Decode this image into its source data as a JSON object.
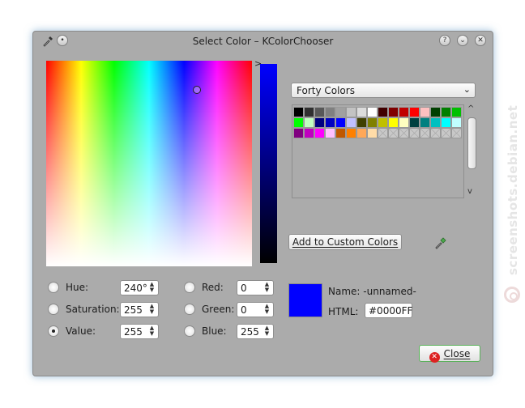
{
  "window": {
    "title": "Select Color – KColorChooser"
  },
  "titlebar_buttons": [
    {
      "name": "help-button",
      "glyph": "?"
    },
    {
      "name": "minimize-button",
      "glyph": "⌄"
    },
    {
      "name": "close-window-button",
      "glyph": "✕"
    }
  ],
  "palette": {
    "selected": "Forty Colors",
    "colors": [
      "#000000",
      "#303030",
      "#585858",
      "#808080",
      "#a0a0a0",
      "#c3c3c3",
      "#dcdcdc",
      "#ffffff",
      "#400000",
      "#800000",
      "#c00000",
      "#ff0000",
      "#ffc0c0",
      "#004000",
      "#008000",
      "#00c000",
      "#00ff00",
      "#c0ffc0",
      "#000080",
      "#0000c0",
      "#0000ff",
      "#c0c0ff",
      "#404000",
      "#808000",
      "#c0c000",
      "#ffff00",
      "#ffffc0",
      "#004040",
      "#008080",
      "#00c0c0",
      "#00ffff",
      "#c0ffff",
      "#800080",
      "#c000c0",
      "#ff00ff",
      "#ffc0ff",
      "#c05800",
      "#ff8000",
      "#ffa858",
      "#ffdca8"
    ]
  },
  "buttons": {
    "add_custom": "Add to Custom Colors",
    "close": "Close"
  },
  "fields": {
    "hue": {
      "label": "Hue:",
      "value": "240°"
    },
    "saturation": {
      "label": "Saturation:",
      "value": "255"
    },
    "value": {
      "label": "Value:",
      "value": "255"
    },
    "red": {
      "label": "Red:",
      "value": "0"
    },
    "green": {
      "label": "Green:",
      "value": "0"
    },
    "blue": {
      "label": "Blue:",
      "value": "255"
    }
  },
  "selected_radio": "value",
  "current": {
    "name_label": "Name:",
    "name_value": "-unnamed-",
    "html_label": "HTML:",
    "html_value": "#0000FF",
    "color": "#0000ff"
  },
  "watermark": "screenshots.debian.net"
}
